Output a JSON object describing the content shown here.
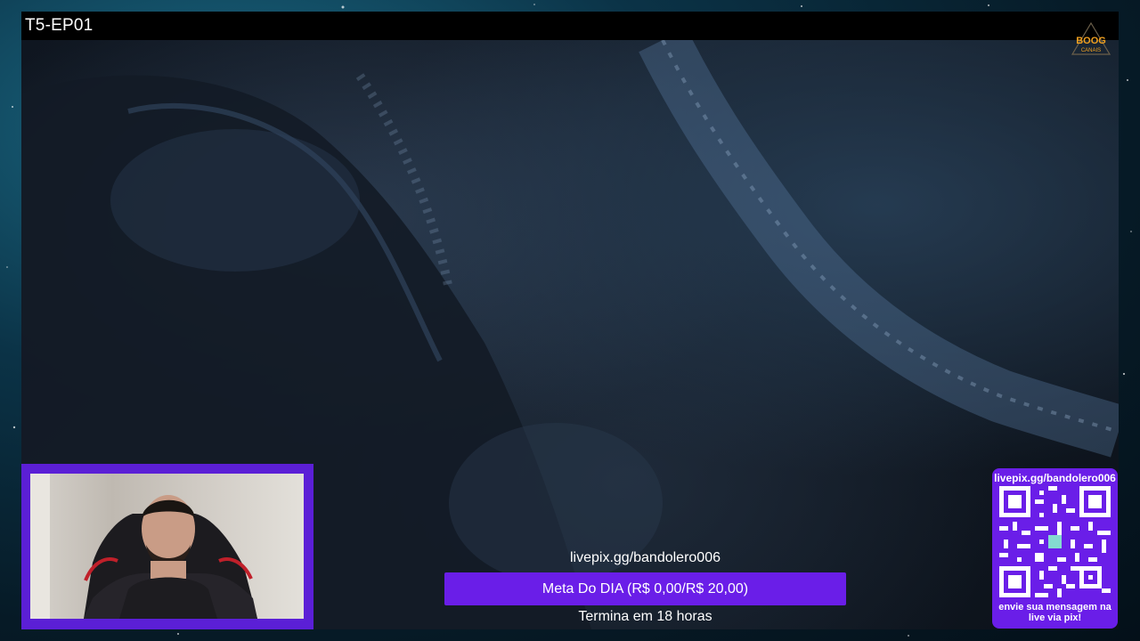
{
  "episode_title": "T5-EP01",
  "logo": {
    "line1": "BOOG",
    "line2": "CANAIS"
  },
  "goal": {
    "link": "livepix.gg/bandolero006",
    "label": "Meta Do DIA (R$ 0,00/R$ 20,00)",
    "current": 0,
    "target": 20,
    "footer": "Termina em 18 horas"
  },
  "pix": {
    "url": "livepix.gg/bandolero006",
    "message_line1": "envie sua mensagem na",
    "message_line2": "live via pix!"
  },
  "colors": {
    "accent": "#6a1ee8",
    "logo": "#f0a020"
  }
}
